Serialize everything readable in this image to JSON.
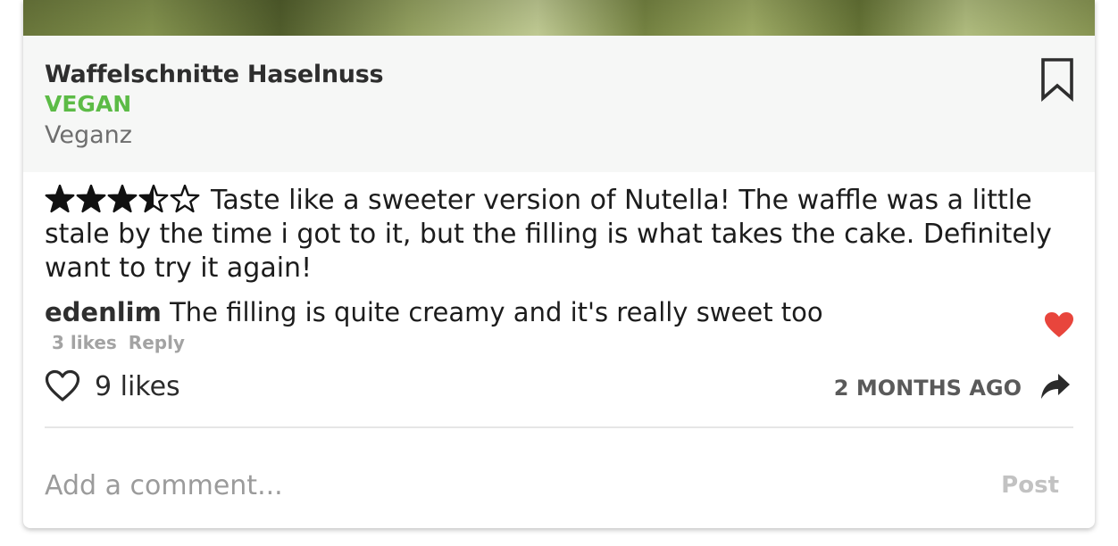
{
  "product": {
    "name": "Waffelschnitte Haselnuss",
    "diet_tag": "VEGAN",
    "brand": "Veganz"
  },
  "review": {
    "rating": 3.5,
    "rating_max": 5,
    "text": "Taste like a sweeter version of Nutella! The waffle was a little stale by the time i got to it, but the filling is what takes the cake. Definitely want to try it again!"
  },
  "comment": {
    "username": "edenlim",
    "text": "The filling is quite creamy and it's really sweet too",
    "likes_label": "3 likes",
    "reply_label": "Reply",
    "liked": true
  },
  "footer": {
    "likes_label": "9 likes",
    "timestamp": "2 MONTHS AGO"
  },
  "comment_box": {
    "placeholder": "Add a comment...",
    "post_label": "Post"
  },
  "icons": {
    "bookmark": "bookmark-icon",
    "star": "star-icon",
    "heart_filled": "heart-filled-icon",
    "heart_outline": "heart-outline-icon",
    "share": "share-icon"
  },
  "colors": {
    "diet_tag": "#5cbb46",
    "comment_heart": "#e8453c",
    "header_bg": "#f6f7f6"
  }
}
